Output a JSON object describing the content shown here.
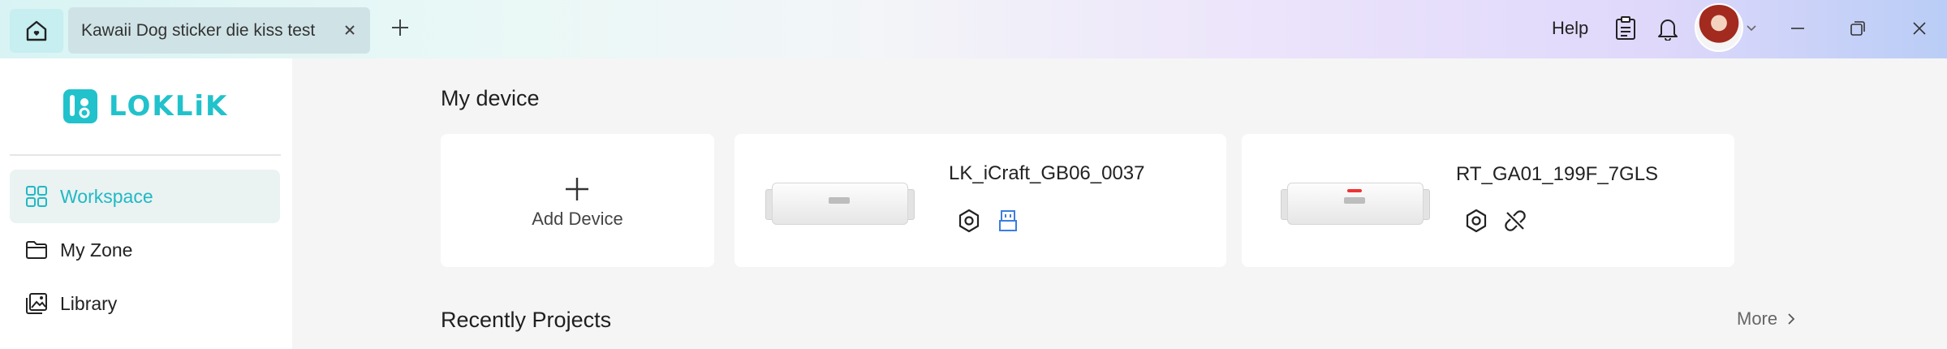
{
  "titlebar": {
    "tab_title": "Kawaii Dog sticker die kiss test",
    "help_label": "Help"
  },
  "sidebar": {
    "logo_text": "LOKLiK",
    "items": [
      {
        "label": "Workspace",
        "icon": "grid-icon",
        "active": true
      },
      {
        "label": "My Zone",
        "icon": "folder-icon",
        "active": false
      },
      {
        "label": "Library",
        "icon": "image-gallery-icon",
        "active": false
      }
    ]
  },
  "main": {
    "my_device_title": "My device",
    "add_device_label": "Add Device",
    "devices": [
      {
        "name": "LK_iCraft_GB06_0037",
        "status_icons": [
          "settings-hex-icon",
          "usb-connected-icon"
        ]
      },
      {
        "name": "RT_GA01_199F_7GLS",
        "status_icons": [
          "settings-hex-icon",
          "disconnected-link-icon"
        ]
      }
    ],
    "recent_title": "Recently Projects",
    "more_label": "More"
  },
  "colors": {
    "accent": "#21c2cb",
    "usb_blue": "#3b7de0"
  }
}
